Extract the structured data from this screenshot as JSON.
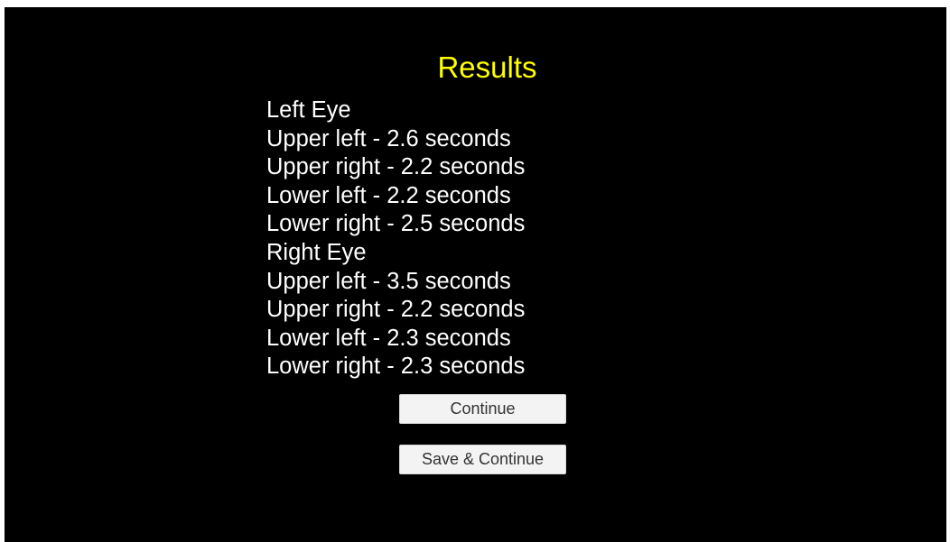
{
  "page": {
    "title": "Results",
    "title_color": "#ffff00",
    "background_color": "#000000"
  },
  "results": {
    "left_eye": {
      "heading": "Left Eye",
      "items": [
        "Upper left - 2.6 seconds",
        "Upper right - 2.2 seconds",
        "Lower left - 2.2 seconds",
        "Lower right - 2.5 seconds"
      ]
    },
    "right_eye": {
      "heading": "Right Eye",
      "items": [
        "Upper left - 3.5 seconds",
        "Upper right - 2.2 seconds",
        "Lower left - 2.3 seconds",
        "Lower right - 2.3 seconds"
      ]
    }
  },
  "buttons": {
    "continue_label": "Continue",
    "save_continue_label": "Save & Continue"
  }
}
